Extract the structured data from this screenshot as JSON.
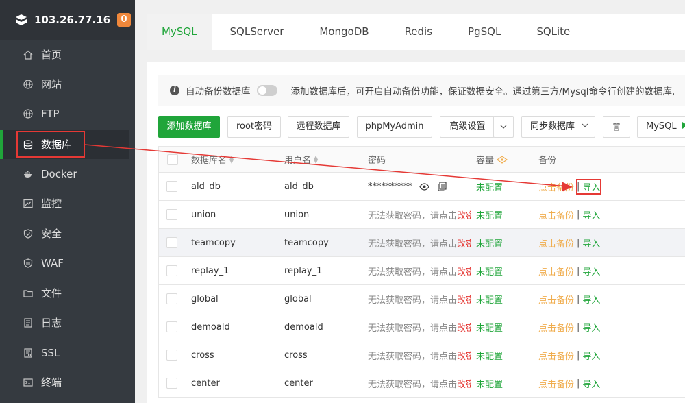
{
  "sidebar": {
    "server_ip": "103.26.77.16",
    "badge": "0",
    "items": [
      {
        "label": "首页",
        "icon": "home-icon"
      },
      {
        "label": "网站",
        "icon": "globe-icon"
      },
      {
        "label": "FTP",
        "icon": "ftp-globe-icon"
      },
      {
        "label": "数据库",
        "icon": "database-icon"
      },
      {
        "label": "Docker",
        "icon": "docker-icon"
      },
      {
        "label": "监控",
        "icon": "monitor-icon"
      },
      {
        "label": "安全",
        "icon": "shield-icon"
      },
      {
        "label": "WAF",
        "icon": "waf-shield-icon"
      },
      {
        "label": "文件",
        "icon": "folder-icon"
      },
      {
        "label": "日志",
        "icon": "log-icon"
      },
      {
        "label": "SSL",
        "icon": "ssl-icon"
      },
      {
        "label": "终端",
        "icon": "terminal-icon"
      }
    ],
    "active_index": 3
  },
  "tabs": [
    "MySQL",
    "SQLServer",
    "MongoDB",
    "Redis",
    "PgSQL",
    "SQLite"
  ],
  "notice": {
    "auto_backup_label": "自动备份数据库",
    "text": "添加数据库后，可开启自动备份功能，保证数据安全。通过第三方/Mysql命令行创建的数据库,"
  },
  "toolbar": {
    "add_db": "添加数据库",
    "root_password": "root密码",
    "remote_db": "远程数据库",
    "phpmyadmin": "phpMyAdmin",
    "advanced": "高级设置",
    "sync_db": "同步数据库",
    "mysql_btn": "MySQL"
  },
  "table": {
    "headers": {
      "name": "数据库名",
      "user": "用户名",
      "password": "密码",
      "capacity": "容量",
      "backup": "备份"
    },
    "rows": [
      {
        "name": "ald_db",
        "user": "ald_db",
        "password": "**********",
        "capacity": "未配置",
        "backup": "点击备份",
        "import": "导入"
      },
      {
        "name": "union",
        "user": "union",
        "password_hint": "无法获取密码，请点击",
        "password_action": "改密",
        "capacity": "未配置",
        "backup": "点击备份",
        "import": "导入"
      },
      {
        "name": "teamcopy",
        "user": "teamcopy",
        "password_hint": "无法获取密码，请点击",
        "password_action": "改密",
        "capacity": "未配置",
        "backup": "点击备份",
        "import": "导入"
      },
      {
        "name": "replay_1",
        "user": "replay_1",
        "password_hint": "无法获取密码，请点击",
        "password_action": "改密",
        "capacity": "未配置",
        "backup": "点击备份",
        "import": "导入"
      },
      {
        "name": "global",
        "user": "global",
        "password_hint": "无法获取密码，请点击",
        "password_action": "改密",
        "capacity": "未配置",
        "backup": "点击备份",
        "import": "导入"
      },
      {
        "name": "demoald",
        "user": "demoald",
        "password_hint": "无法获取密码，请点击",
        "password_action": "改密",
        "capacity": "未配置",
        "backup": "点击备份",
        "import": "导入"
      },
      {
        "name": "cross",
        "user": "cross",
        "password_hint": "无法获取密码，请点击",
        "password_action": "改密",
        "capacity": "未配置",
        "backup": "点击备份",
        "import": "导入"
      },
      {
        "name": "center",
        "user": "center",
        "password_hint": "无法获取密码，请点击",
        "password_action": "改密",
        "capacity": "未配置",
        "backup": "点击备份",
        "import": "导入"
      }
    ]
  },
  "colors": {
    "accent": "#20a53a",
    "annotation": "#e53935",
    "backup_link": "#f0ad4e",
    "sidebar_bg": "#353a40"
  }
}
